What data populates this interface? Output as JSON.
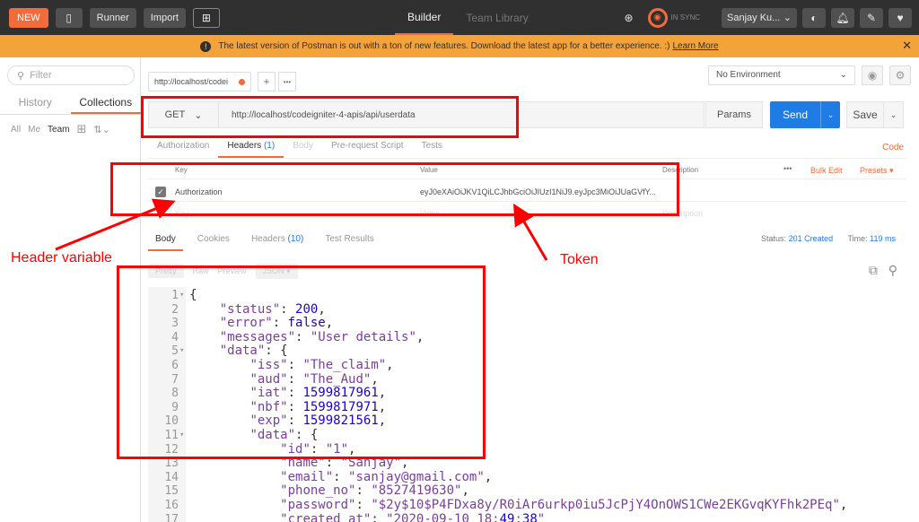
{
  "topbar": {
    "new_label": "NEW",
    "runner_label": "Runner",
    "import_label": "Import",
    "tabs": [
      {
        "label": "Builder"
      },
      {
        "label": "Team Library"
      }
    ],
    "sync_label": "IN SYNC",
    "user_label": "Sanjay Ku..."
  },
  "banner": {
    "text": "The latest version of Postman is out with a ton of new features. Download the latest app for a better experience. :)",
    "link": "Learn More",
    "close": "✕"
  },
  "sidebar": {
    "filter_placeholder": "Filter",
    "tabs": [
      {
        "label": "History"
      },
      {
        "label": "Collections"
      }
    ],
    "tools": {
      "all": "All",
      "me": "Me",
      "team": "Team"
    }
  },
  "request": {
    "tab_title": "http://localhost/codei",
    "add": "+",
    "more": "•••",
    "environment": "No Environment",
    "method": "GET",
    "url": "http://localhost/codeigniter-4-apis/api/userdata",
    "params_label": "Params",
    "send_label": "Send",
    "save_label": "Save",
    "sub_tabs": [
      {
        "label": "Authorization"
      },
      {
        "label": "Headers",
        "count": "(1)"
      },
      {
        "label": "Body"
      },
      {
        "label": "Pre-request Script"
      },
      {
        "label": "Tests"
      }
    ],
    "code_link": "Code"
  },
  "headers_table": {
    "col_key": "Key",
    "col_value": "Value",
    "col_desc": "Description",
    "more": "•••",
    "bulk_edit": "Bulk Edit",
    "presets": "Presets ▾",
    "rows": [
      {
        "key": "Authorization",
        "value": "eyJ0eXAiOiJKV1QiLCJhbGciOiJIUzI1NiJ9.eyJpc3MiOiJUaGVfY..."
      }
    ],
    "placeholder_key": "Key",
    "placeholder_value": "Value",
    "placeholder_desc": "Description"
  },
  "response": {
    "tabs": [
      {
        "label": "Body"
      },
      {
        "label": "Cookies"
      },
      {
        "label": "Headers",
        "count": "(10)"
      },
      {
        "label": "Test Results"
      }
    ],
    "status_label": "Status:",
    "status_value": "201 Created",
    "time_label": "Time:",
    "time_value": "119 ms",
    "view_pretty": "Pretty",
    "view_raw": "Raw",
    "view_preview": "Preview",
    "view_format": "JSON ▾"
  },
  "code_lines": [
    {
      "n": "1",
      "fold": "▾",
      "t": "{"
    },
    {
      "n": "2",
      "t": "    \"status\": 200,"
    },
    {
      "n": "3",
      "t": "    \"error\": false,"
    },
    {
      "n": "4",
      "t": "    \"messages\": \"User details\","
    },
    {
      "n": "5",
      "fold": "▾",
      "t": "    \"data\": {"
    },
    {
      "n": "6",
      "t": "        \"iss\": \"The_claim\","
    },
    {
      "n": "7",
      "t": "        \"aud\": \"The_Aud\","
    },
    {
      "n": "8",
      "t": "        \"iat\": 1599817961,"
    },
    {
      "n": "9",
      "t": "        \"nbf\": 1599817971,"
    },
    {
      "n": "10",
      "t": "        \"exp\": 1599821561,"
    },
    {
      "n": "11",
      "fold": "▾",
      "t": "        \"data\": {"
    },
    {
      "n": "12",
      "t": "            \"id\": \"1\","
    },
    {
      "n": "13",
      "t": "            \"name\": \"Sanjay\","
    },
    {
      "n": "14",
      "t": "            \"email\": \"sanjay@gmail.com\","
    },
    {
      "n": "15",
      "t": "            \"phone_no\": \"8527419630\","
    },
    {
      "n": "16",
      "t": "            \"password\": \"$2y$10$P4FDxa8y/R0iAr6urkp0iu5JcPjY4OnOWS1CWe2EKGvqKYFhk2PEq\","
    },
    {
      "n": "17",
      "t": "            \"created_at\": \"2020-09-10 18:49:38\""
    }
  ],
  "annotations": {
    "header_variable": "Header variable",
    "token": "Token"
  },
  "colors": {
    "accent": "#f26b3a",
    "send_blue": "#1f7ce4",
    "annotation_red": "#ff0000",
    "banner": "#f2a33a"
  }
}
